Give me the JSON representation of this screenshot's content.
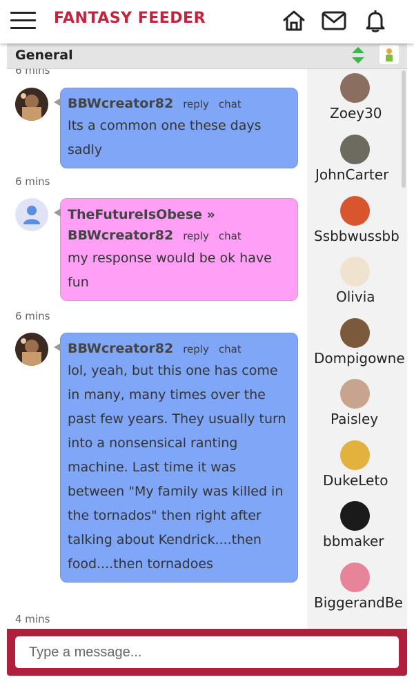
{
  "header": {
    "brand": "FANTASY FEEDER",
    "icons": [
      "menu-icon",
      "home-icon",
      "mail-icon",
      "bell-icon"
    ]
  },
  "channel": {
    "name": "General"
  },
  "messages": [
    {
      "time_before": "6 mins",
      "author": "BBWcreator82",
      "reply_to": "",
      "text": "Its a common one these days sadly",
      "color": "#7fa6f7"
    },
    {
      "time_before": "6 mins",
      "author": "TheFutureIsObese »",
      "reply_to": "BBWcreator82",
      "text": "my response would be ok have fun",
      "color": "#ff9ff6"
    },
    {
      "time_before": "6 mins",
      "author": "BBWcreator82",
      "reply_to": "",
      "text": "lol, yeah, but this one has come in many, many times over the past few years. They usually turn into a nonsensical ranting machine. Last time it was between \"My family was killed in the tornados\" then right after talking about Kendrick....then food....then tornadoes",
      "color": "#7fa6f7"
    }
  ],
  "trailing_time": "4 mins",
  "actions": {
    "reply": "reply",
    "chat": "chat"
  },
  "users": [
    {
      "name": "Zoey30"
    },
    {
      "name": "JohnCarter"
    },
    {
      "name": "Ssbbwussbb"
    },
    {
      "name": "Olivia"
    },
    {
      "name": "Dompigowne"
    },
    {
      "name": "Paisley"
    },
    {
      "name": "DukeLeto"
    },
    {
      "name": "bbmaker"
    },
    {
      "name": "BiggerandBe"
    }
  ],
  "input": {
    "placeholder": "Type a message..."
  },
  "colors": {
    "brand": "#c8223b",
    "input_bar": "#b0203c",
    "bubble_blue": "#7fa6f7",
    "bubble_pink": "#ff9ff6"
  }
}
